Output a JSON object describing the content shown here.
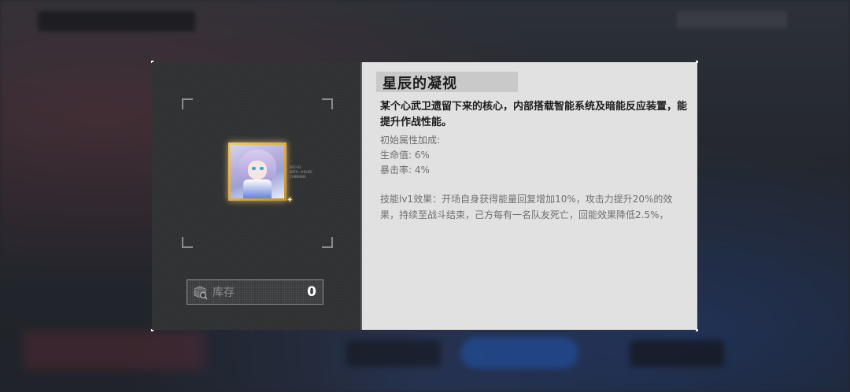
{
  "item": {
    "name": "星辰的凝视",
    "description": "某个心武卫遗留下来的核心，内部搭载智能系统及暗能反应装置，能提升作战性能。",
    "attributes_header": "初始属性加成:",
    "attributes": [
      "生命值: 6%",
      "暴击率: 4%"
    ],
    "skill_text": "技能lv1效果：开场自身获得能量回复增加10%，攻击力提升20%的效果，持续至战斗结束，己方每有一名队友死亡，回能效果降低2.5%，",
    "card_meta": "XCE-03\nDATA—#DUKE\nCHIBRENS",
    "frame_color": "#e8b34a"
  },
  "inventory": {
    "label": "库存",
    "count": "0"
  },
  "colors": {
    "left_panel": "#2e2f31",
    "right_panel": "#e1e1e1",
    "accent_gold": "#e8b34a"
  }
}
